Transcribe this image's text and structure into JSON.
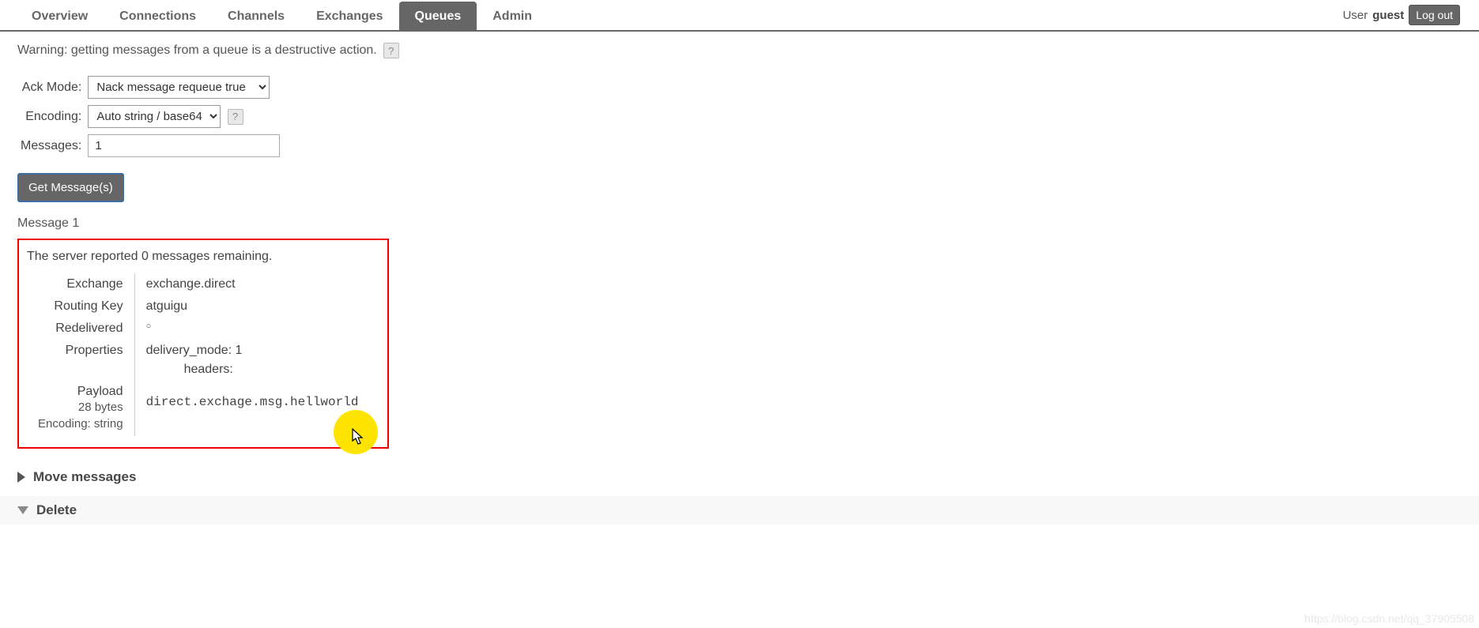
{
  "tabs": {
    "items": [
      {
        "label": "Overview",
        "active": false
      },
      {
        "label": "Connections",
        "active": false
      },
      {
        "label": "Channels",
        "active": false
      },
      {
        "label": "Exchanges",
        "active": false
      },
      {
        "label": "Queues",
        "active": true
      },
      {
        "label": "Admin",
        "active": false
      }
    ]
  },
  "user": {
    "label": "User",
    "name": "guest",
    "logout": "Log out"
  },
  "warning": {
    "text": "Warning: getting messages from a queue is a destructive action.",
    "help": "?"
  },
  "form": {
    "ack_mode": {
      "label": "Ack Mode:",
      "value": "Nack message requeue true"
    },
    "encoding": {
      "label": "Encoding:",
      "value": "Auto string / base64",
      "help": "?"
    },
    "messages": {
      "label": "Messages:",
      "value": "1"
    },
    "submit": "Get Message(s)"
  },
  "result": {
    "heading": "Message 1",
    "remaining": "The server reported 0 messages remaining.",
    "rows": {
      "exchange": {
        "label": "Exchange",
        "value": "exchange.direct"
      },
      "routing_key": {
        "label": "Routing Key",
        "value": "atguigu"
      },
      "redelivered": {
        "label": "Redelivered",
        "value": "○"
      },
      "properties": {
        "label": "Properties",
        "value1": "delivery_mode: 1",
        "value2": "headers:"
      },
      "payload": {
        "label": "Payload",
        "size": "28 bytes",
        "encoding": "Encoding: string",
        "value": "direct.exchage.msg.hellworld"
      }
    }
  },
  "sections": {
    "move": "Move messages",
    "delete": "Delete"
  },
  "watermark": "https://blog.csdn.net/qq_37905508"
}
